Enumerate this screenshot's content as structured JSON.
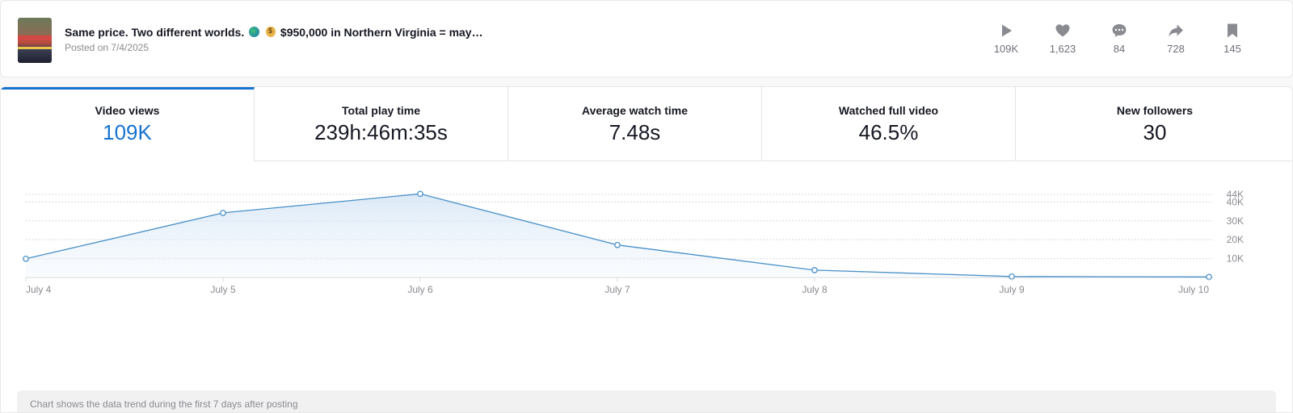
{
  "post": {
    "title_a": "Same price. Two different worlds.",
    "title_b": "$950,000 in Northern Virginia = may…",
    "posted": "Posted on 7/4/2025"
  },
  "stats": [
    {
      "name": "play",
      "icon": "play-icon",
      "value": "109K"
    },
    {
      "name": "likes",
      "icon": "heart-icon",
      "value": "1,623"
    },
    {
      "name": "comments",
      "icon": "comment-icon",
      "value": "84"
    },
    {
      "name": "shares",
      "icon": "share-icon",
      "value": "728"
    },
    {
      "name": "saves",
      "icon": "bookmark-icon",
      "value": "145"
    }
  ],
  "tabs": [
    {
      "label": "Video views",
      "value": "109K",
      "active": true
    },
    {
      "label": "Total play time",
      "value": "239h:46m:35s",
      "active": false
    },
    {
      "label": "Average watch time",
      "value": "7.48s",
      "active": false
    },
    {
      "label": "Watched full video",
      "value": "46.5%",
      "active": false
    },
    {
      "label": "New followers",
      "value": "30",
      "active": false
    }
  ],
  "accent_color": "#1773d0",
  "chart_data": {
    "type": "area",
    "categories": [
      "July 4",
      "July 5",
      "July 6",
      "July 7",
      "July 8",
      "July 9",
      "July 10"
    ],
    "values": [
      9900,
      34200,
      44300,
      17200,
      3900,
      500,
      300
    ],
    "ylim": [
      0,
      44000
    ],
    "y_ticks": [
      10000,
      20000,
      30000,
      40000,
      44000
    ],
    "y_tick_labels": [
      "10K",
      "20K",
      "30K",
      "40K",
      "44K"
    ],
    "y_axis_side": "right",
    "grid": true,
    "line_color": "#4a90c8"
  },
  "footnote": "Chart shows the data trend during the first 7 days after posting"
}
